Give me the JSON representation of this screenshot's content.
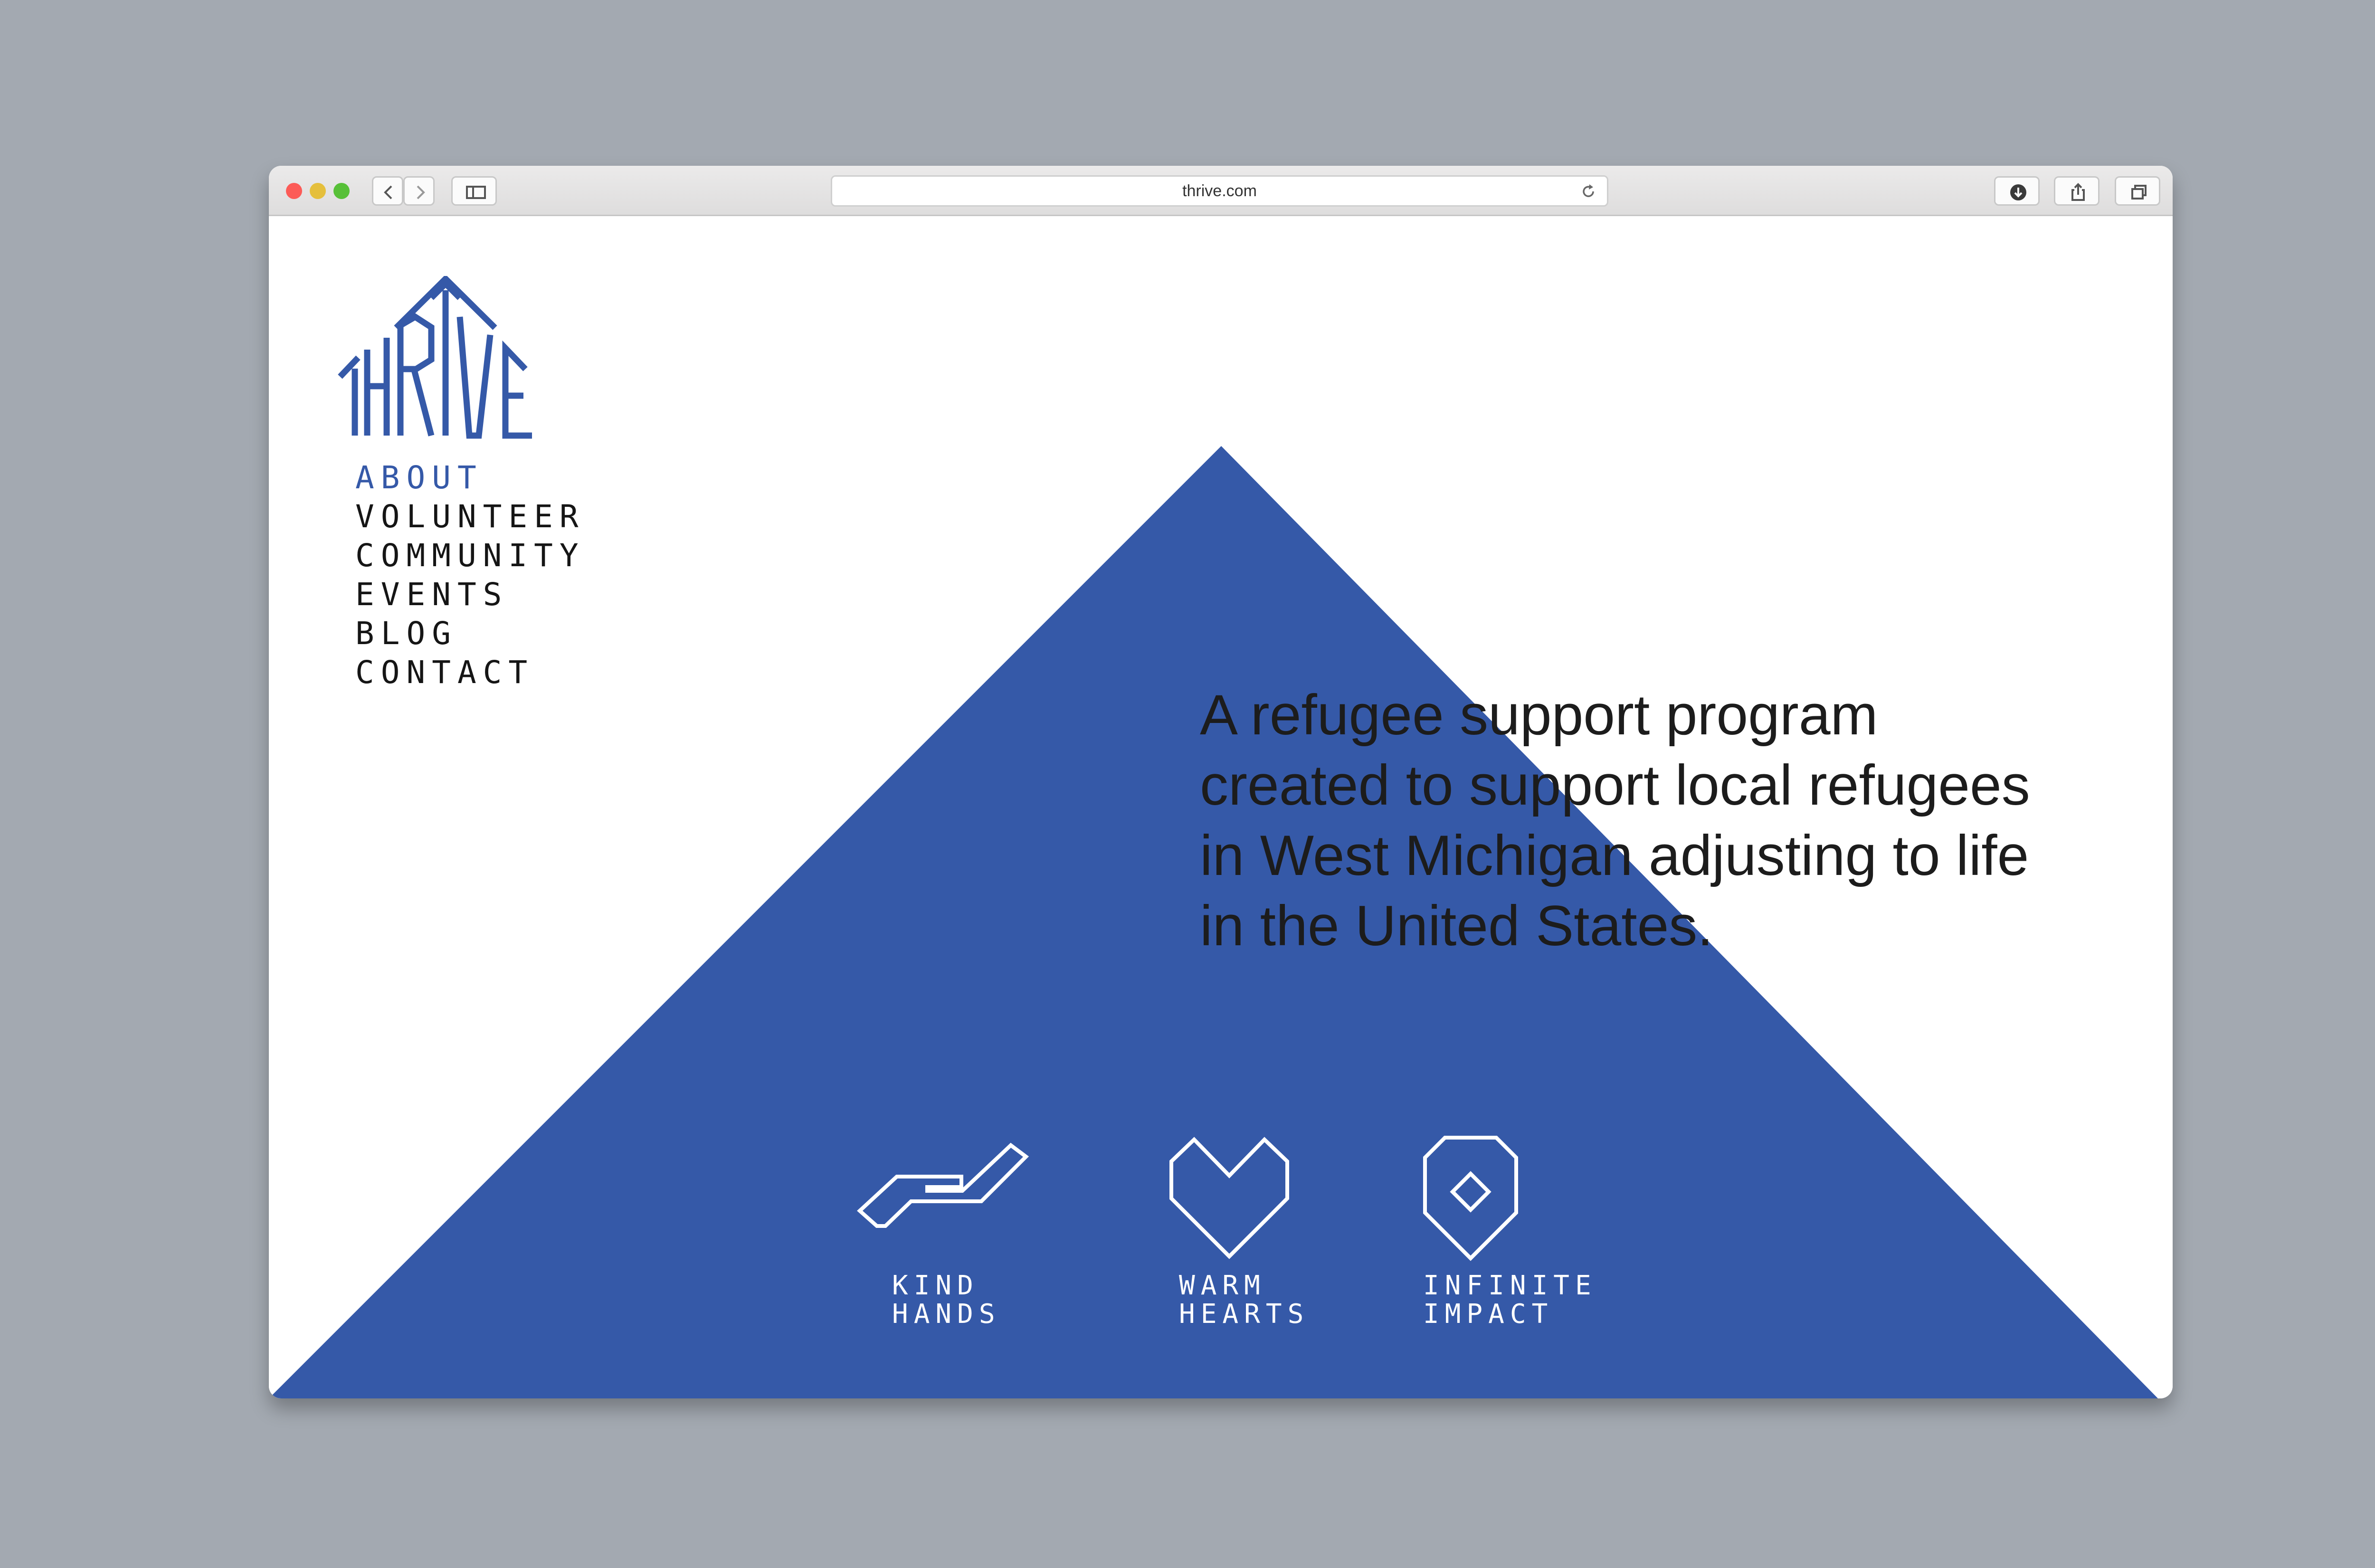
{
  "browser": {
    "url": "thrive.com",
    "traffic_lights": [
      "#fc5b57",
      "#e5bf3c",
      "#57c038"
    ]
  },
  "logo": {
    "text": "THRIVE",
    "color": "#3559a8"
  },
  "nav": {
    "items": [
      {
        "label": "ABOUT",
        "active": true
      },
      {
        "label": "VOLUNTEER",
        "active": false
      },
      {
        "label": "COMMUNITY",
        "active": false
      },
      {
        "label": "EVENTS",
        "active": false
      },
      {
        "label": "BLOG",
        "active": false
      },
      {
        "label": "CONTACT",
        "active": false
      }
    ]
  },
  "hero": {
    "accent_color": "#3559a8",
    "tagline_lines": [
      "A refugee support program",
      "created to support local refugees",
      "in West Michigan adjusting to life",
      "in the United States."
    ]
  },
  "features": [
    {
      "icon": "hand-icon",
      "line1": "KIND",
      "line2": "HANDS"
    },
    {
      "icon": "heart-icon",
      "line1": "WARM",
      "line2": "HEARTS"
    },
    {
      "icon": "location-pin-icon",
      "line1": "INFINITE",
      "line2": "IMPACT"
    }
  ]
}
